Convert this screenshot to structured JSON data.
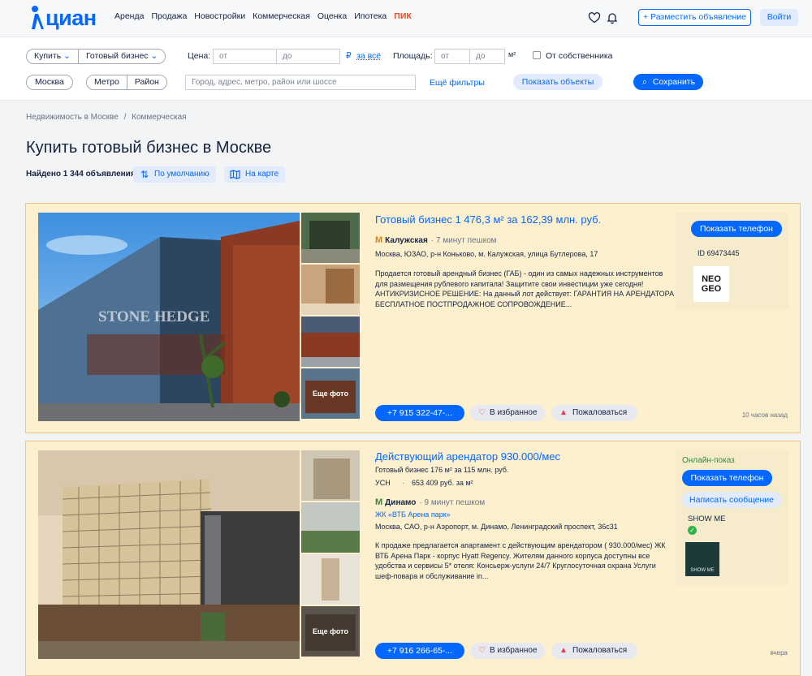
{
  "header": {
    "logo_text": "циан",
    "nav": [
      "Аренда",
      "Продажа",
      "Новостройки",
      "Коммерческая",
      "Оценка",
      "Ипотека",
      "ПИК"
    ],
    "post_button": "+ Разместить объявление",
    "login_button": "Войти",
    "accent": "#0468ff"
  },
  "filters": {
    "deal": "Купить",
    "type": "Готовый бизнес",
    "price_label": "Цена:",
    "price_from": "от",
    "price_to": "до",
    "currency": "₽",
    "price_period": "за всё",
    "area_label": "Площадь:",
    "area_from": "от",
    "area_to": "до",
    "area_unit": "м²",
    "owner_label": "От собственника",
    "city": "Москва",
    "metro": "Метро",
    "district": "Район",
    "search_placeholder": "Город, адрес, метро, район или шоссе",
    "more_filters": "Ещё фильтры",
    "show_button": "Показать объекты",
    "save_button": "Сохранить"
  },
  "page": {
    "breadcrumb": [
      "Недвижимость в Москве",
      "Коммерческая"
    ],
    "breadcrumb_sep": "/",
    "title": "Купить готовый бизнес в Москве",
    "found": "Найдено 1 344 объявления",
    "sort": "По умолчанию",
    "map": "На карте"
  },
  "listings": [
    {
      "title": "Готовый бизнес 1 476,3 м² за 162,39 млн. руб.",
      "metro": "Калужская",
      "walk": "· 7 минут пешком",
      "address": "Москва, ЮЗАО, р-н Коньково, м. Калужская, улица Бутлерова, 17",
      "description": "Продается готовый арендный бизнес (ГАБ) - один из самых надежных инструментов для размещения рублевого капитала! Защитите свои инвестиции уже сегодня! АНТИКРИЗИСНОЕ РЕШЕНИЕ: На данный лот действует: ГАРАНТИЯ НА АРЕНДАТОРА БЕСПЛАТНОЕ ПОСТПРОДАЖНОЕ СОПРОВОЖДЕНИЕ...",
      "more_photos": "Еще фото",
      "phone": "+7 915 322-47-...",
      "favorite": "В избранное",
      "report": "Пожаловаться",
      "show_phone": "Показать телефон",
      "id": "ID 69473445",
      "agency_logo": "NEO GEO",
      "time": "10 часов назад"
    },
    {
      "title": "Действующий арендатор 930.000/мес",
      "subtitle": "Готовый бизнес 176 м² за 115 млн. руб.",
      "tax": "УСН",
      "price_per_m": "653 409 руб. за м²",
      "metro": "Динамо",
      "walk": "· 9 минут пешком",
      "complex": "ЖК «ВТБ Арена парк»",
      "address": "Москва, САО, р-н Аэропорт, м. Динамо, Ленинградский проспект, 36с31",
      "description": "К продаже предлагается апартамент с действующим арендатором ( 930.000/мес) ЖК ВТБ Арена Парк - корпус Hyatt Regency. Жителям данного корпуса доступны все удобства и сервисы 5* отеля: Консьерж-услуги 24/7 Круглосуточная охрана Услуги шеф-повара и обслуживание in...",
      "more_photos": "Еще фото",
      "phone": "+7 916 266-65-...",
      "favorite": "В избранное",
      "report": "Пожаловаться",
      "online": "Онлайн-показ",
      "show_phone": "Показать телефон",
      "message": "Написать сообщение",
      "agency": "SHOW ME",
      "agency_logo": "SHOW ME",
      "time": "вчера"
    }
  ]
}
